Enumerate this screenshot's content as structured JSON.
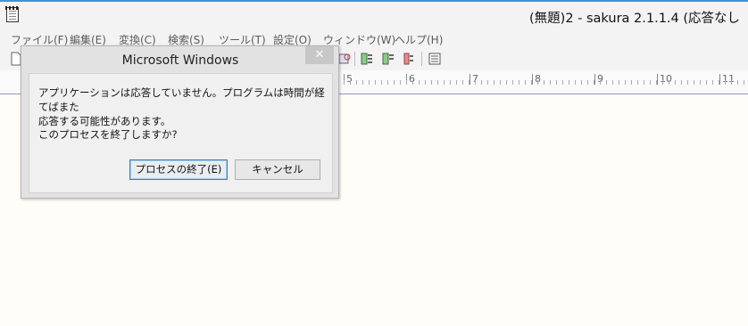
{
  "window": {
    "title": "(無題)2 - sakura 2.1.1.4  (応答なし"
  },
  "menu": {
    "items": [
      "ファイル(F)",
      "編集(E)",
      "変換(C)",
      "検索(S)",
      "ツール(T)",
      "設定(O)",
      "ウィンドウ(W)",
      "ヘルプ(H)"
    ]
  },
  "ruler": {
    "labels": [
      "5",
      "6",
      "7",
      "8",
      "9",
      "10",
      "11"
    ]
  },
  "dialog": {
    "title": "Microsoft Windows",
    "close_label": "✕",
    "message_line1": "アプリケーションは応答していません。プログラムは時間が経てばまた",
    "message_line2": "応答する可能性があります。",
    "question": "このプロセスを終了しますか?",
    "end_process_label": "プロセスの終了(E)",
    "cancel_label": "キャンセル"
  },
  "colors": {
    "accent": "#3a96dd",
    "editor_bg": "#fffdf8",
    "ruler_line": "#9a8fc8"
  }
}
